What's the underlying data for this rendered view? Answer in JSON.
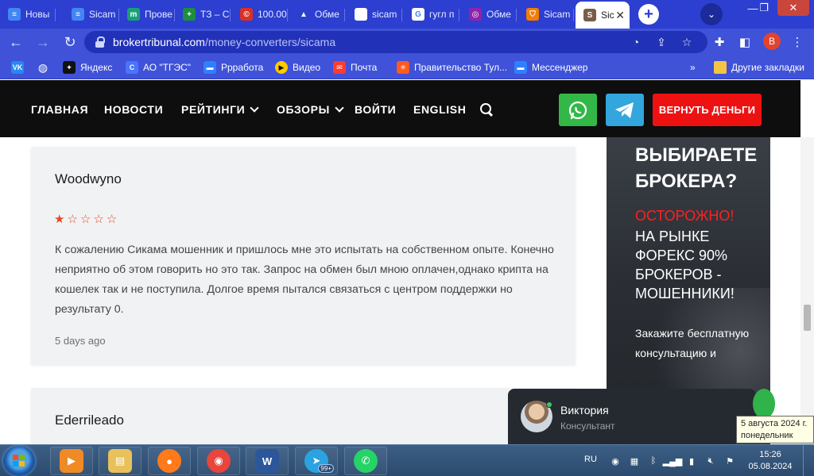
{
  "browser": {
    "tabs": [
      {
        "label": "Новы",
        "icon": "google-docs-icon",
        "color": "#4285f4",
        "glyph": "≡"
      },
      {
        "label": "Sicam",
        "icon": "google-docs-icon",
        "color": "#4285f4",
        "glyph": "≡"
      },
      {
        "label": "Прове",
        "icon": "m-icon",
        "color": "#1a9f7a",
        "glyph": "m"
      },
      {
        "label": "ТЗ – С",
        "icon": "google-sheets-icon",
        "color": "#1e8e3e",
        "glyph": "+"
      },
      {
        "label": "100.00",
        "icon": "copyright-icon",
        "color": "#d93025",
        "glyph": "©"
      },
      {
        "label": "Обме",
        "icon": "triangle-logo-icon",
        "color": "#2c3fd0",
        "glyph": "▲"
      },
      {
        "label": "sicam",
        "icon": "blank-page-icon",
        "color": "#ffffff",
        "glyph": ""
      },
      {
        "label": "гугл п",
        "icon": "google-icon",
        "color": "#ffffff",
        "glyph": "G"
      },
      {
        "label": "Обме",
        "icon": "exchange-icon",
        "color": "#8e24aa",
        "glyph": "◎"
      },
      {
        "label": "Sicam",
        "icon": "shield-icon",
        "color": "#f57c00",
        "glyph": "⛉"
      },
      {
        "label": "Sic",
        "icon": "site-icon",
        "color": "#7a5c4a",
        "glyph": "S"
      }
    ],
    "new_tab_symbol": "+",
    "window_controls": {
      "minimize": "—",
      "restore": "❐",
      "close": "✕"
    },
    "url": {
      "host": "brokertribunal.com",
      "path": "/money-converters/sicama"
    },
    "profile_initial": "B",
    "bookmarks": [
      {
        "label": "",
        "icon": "vk-icon",
        "color": "#2787f5",
        "glyph": "VK"
      },
      {
        "label": "",
        "icon": "globe-icon",
        "color": "#ffffff",
        "glyph": "◍"
      },
      {
        "label": "Яндекс",
        "icon": "yandex-icon",
        "color": "#111111",
        "glyph": "✦"
      },
      {
        "label": "АО \"ТГЭС\"",
        "icon": "tges-icon",
        "color": "#4a73ff",
        "glyph": "C"
      },
      {
        "label": "Ррработа",
        "icon": "chat-bubble-icon",
        "color": "#2f80ff",
        "glyph": "▬"
      },
      {
        "label": "Видео",
        "icon": "play-icon",
        "color": "#ffcc00",
        "glyph": "▶"
      },
      {
        "label": "Почта",
        "icon": "mail-icon",
        "color": "#ff3b30",
        "glyph": "✉"
      },
      {
        "label": "Правительство Тул...",
        "icon": "government-icon",
        "color": "#ff5a1f",
        "glyph": "✳"
      },
      {
        "label": "Мессенджер",
        "icon": "messenger-icon",
        "color": "#2f80ff",
        "glyph": "▬"
      }
    ],
    "bookmarks_overflow": "»",
    "other_bookmarks": "Другие закладки"
  },
  "site": {
    "nav": {
      "home": "ГЛАВНАЯ",
      "news": "НОВОСТИ",
      "ratings": "РЕЙТИНГИ",
      "reviews": "ОБЗОРЫ",
      "login": "ВОЙТИ",
      "english": "ENGLISH"
    },
    "refund_button": "ВЕРНУТЬ ДЕНЬГИ",
    "colors": {
      "accent_red": "#ee1111",
      "whatsapp_green": "#33b848",
      "telegram_blue": "#32a6dd",
      "star_orange": "#e8461e"
    }
  },
  "reviews": [
    {
      "author": "Woodwyno",
      "rating": 1,
      "max_rating": 5,
      "text": "К сожалению Сикама мошенник и пришлось мне это испытать на собственном опыте. Конечно неприятно об этом говорить но это так. Запрос на обмен был мною оплачен,однако крипта на кошелек так и не поступила. Долгое время пытался связаться с центром поддержки но результату 0.",
      "date": "5 days ago"
    },
    {
      "author": "Ederrileado"
    }
  ],
  "ad": {
    "title": "ВЫБИРАЕТЕ БРОКЕРА?",
    "warning": "ОСТОРОЖНО!",
    "body": "НА РЫНКЕ ФОРЕКС 90% БРОКЕРОВ - МОШЕННИКИ!",
    "cta": "Закажите бесплатную консультацию и"
  },
  "chat": {
    "name": "Виктория",
    "role": "Консультант"
  },
  "tooltip": {
    "line1": "5 августа 2024 г.",
    "line2": "понедельник"
  },
  "taskbar": {
    "apps": [
      {
        "icon": "media-player-icon",
        "color": "#f08a24",
        "glyph": "▶"
      },
      {
        "icon": "file-explorer-icon",
        "color": "#e8c15a",
        "glyph": "▤"
      },
      {
        "icon": "firefox-icon",
        "color": "#ff7a1a",
        "glyph": "●"
      },
      {
        "icon": "chrome-icon",
        "color": "#e8453c",
        "glyph": "◉"
      },
      {
        "icon": "word-icon",
        "color": "#2b579a",
        "glyph": "W"
      },
      {
        "icon": "telegram-icon",
        "color": "#2aa3e0",
        "glyph": "➤"
      },
      {
        "icon": "whatsapp-icon",
        "color": "#25d366",
        "glyph": "✆"
      }
    ],
    "telegram_badge": "99+",
    "language": "RU",
    "time": "15:26",
    "date": "05.08.2024"
  }
}
